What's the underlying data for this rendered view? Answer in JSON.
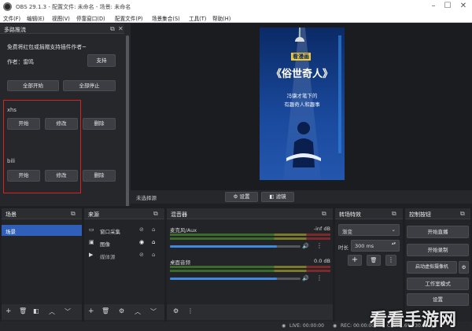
{
  "app": {
    "title": "OBS 29.1.3 - 配置文件: 未命名 - 场景: 未命名"
  },
  "menu": [
    "文件(F)",
    "编辑(E)",
    "视图(V)",
    "停靠窗口(D)",
    "配置文件(P)",
    "场景集合(S)",
    "工具(T)",
    "帮助(H)"
  ],
  "plugin_panel": {
    "title": "多路推流",
    "notice": "免费将红包或捐赠支持插件作者~",
    "author_label": "作者：雷鸣",
    "support_button": "支持",
    "start_all": "全部开始",
    "stop_all": "全部停止",
    "targets": [
      {
        "name": "xhs",
        "start": "开始",
        "edit": "修改",
        "delete": "删除"
      },
      {
        "name": "bili",
        "start": "开始",
        "edit": "修改",
        "delete": "删除"
      }
    ]
  },
  "poster": {
    "tag": "看漫画",
    "title": "《俗世奇人》",
    "line1": "冯骥才笔下的",
    "line2": "有趣奇人和趣事"
  },
  "preview_bar": {
    "status": "未选择源",
    "settings": "设置",
    "filters": "滤镜"
  },
  "scenes": {
    "title": "场景",
    "items": [
      "场景"
    ]
  },
  "sources": {
    "title": "来源",
    "items": [
      "窗口采集",
      "图像",
      "媒体源"
    ]
  },
  "mixer": {
    "title": "混音器",
    "channels": [
      {
        "name": "麦克风/Aux",
        "level": "-inf dB",
        "volume": 0.82
      },
      {
        "name": "桌面音频",
        "level": "0.0 dB",
        "volume": 0.82
      }
    ]
  },
  "transitions": {
    "title": "转场特效",
    "type": "渐变",
    "duration_label": "时长",
    "duration": "300 ms"
  },
  "controls": {
    "title": "控制按钮",
    "start_stream": "开始直播",
    "start_record": "开始录制",
    "virtual_cam": "启动虚拟摄像机",
    "studio_mode": "工作室模式",
    "settings": "设置"
  },
  "status": {
    "live": "LIVE: 00:00:00",
    "rec": "REC: 00:00:00",
    "cpu": "CPU: 1.6%, 30.00 fps"
  },
  "watermark": "看看手游网"
}
